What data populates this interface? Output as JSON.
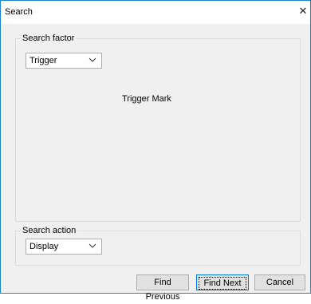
{
  "window": {
    "title": "Search",
    "close_label": "✕"
  },
  "search_factor": {
    "legend": "Search factor",
    "selected": "Trigger",
    "content_text": "Trigger Mark"
  },
  "search_action": {
    "legend": "Search action",
    "selected": "Display"
  },
  "buttons": {
    "find_previous": "Find Previous",
    "find_next": "Find Next",
    "cancel": "Cancel"
  }
}
